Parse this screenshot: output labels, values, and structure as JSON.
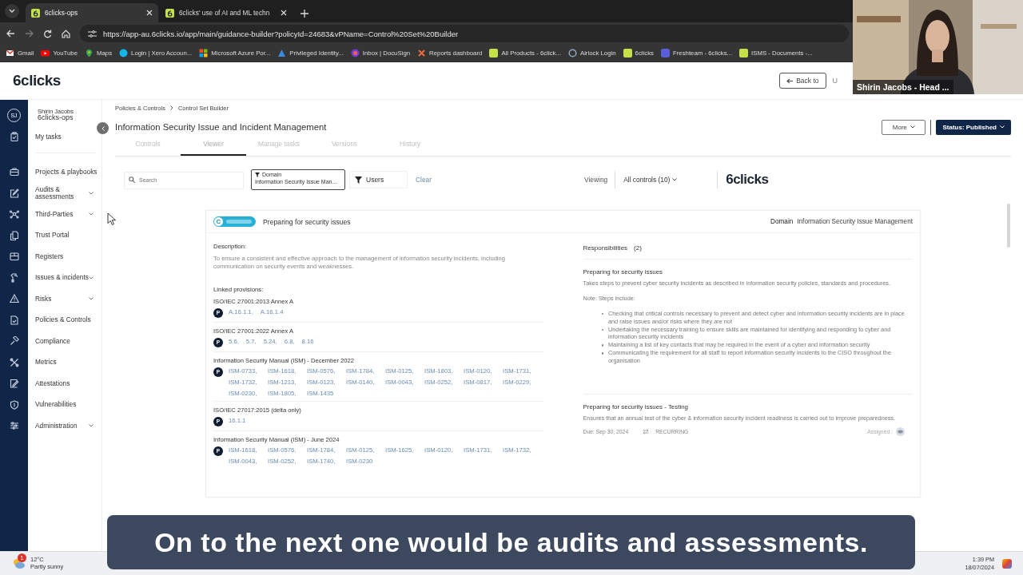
{
  "browser": {
    "tabs": [
      {
        "title": "6clicks-ops",
        "selected": true
      },
      {
        "title": "6clicks' use of AI and ML techn",
        "selected": false
      }
    ],
    "url": "https://app-au.6clicks.io/app/main/guidance-builder?policyId=24683&vPName=Control%20Set%20Builder",
    "bookmarks": [
      "Gmail",
      "YouTube",
      "Maps",
      "Login | Xero Accoun...",
      "Microsoft Azure Por...",
      "Privileged Identity...",
      "Inbox | DocuSign",
      "Reports dashboard",
      "All Products - 6click...",
      "Airlock Login",
      "6clicks",
      "Freshteam - 6clicks...",
      "ISMS - Documents -..."
    ]
  },
  "video": {
    "kind": "picture",
    "caption": "Shirin Jacobs - Head ..."
  },
  "app_header": {
    "logo": "6clicks",
    "back_button": "Back to",
    "next_button": "U"
  },
  "sidebar": {
    "user": {
      "initials": "SJ",
      "name": "Shirin Jacobs",
      "org": "6clicks-ops"
    },
    "my_tasks": "My tasks",
    "items": [
      {
        "label": "Projects & playbooks",
        "expandable": false
      },
      {
        "label": "Audits & assessments",
        "expandable": true
      },
      {
        "label": "Third-Parties",
        "expandable": true
      },
      {
        "label": "Trust Portal",
        "expandable": false
      },
      {
        "label": "Registers",
        "expandable": false
      },
      {
        "label": "Issues & incidents",
        "expandable": true
      },
      {
        "label": "Risks",
        "expandable": true
      },
      {
        "label": "Policies & Controls",
        "expandable": false
      },
      {
        "label": "Compliance",
        "expandable": false
      },
      {
        "label": "Metrics",
        "expandable": false
      },
      {
        "label": "Attestations",
        "expandable": false
      },
      {
        "label": "Vulnerabilities",
        "expandable": false
      },
      {
        "label": "Administration",
        "expandable": true
      }
    ]
  },
  "main": {
    "breadcrumb": [
      "Policies & Controls",
      "Control Set Builder"
    ],
    "title": "Information Security Issue and Incident Management",
    "more_button": "More",
    "status_button": "Status: Published",
    "tabs": [
      {
        "label": "Controls",
        "selected": false
      },
      {
        "label": "Viewer",
        "selected": true
      },
      {
        "label": "Manage tasks",
        "selected": false
      },
      {
        "label": "Versions",
        "selected": false
      },
      {
        "label": "History",
        "selected": false
      }
    ],
    "filters": {
      "search_placeholder": "Search",
      "domain_label": "Domain",
      "domain_value": "Information Security Issue Man...",
      "users": "Users",
      "clear": "Clear",
      "viewing_label": "Viewing",
      "viewing_value": "All controls (10)",
      "logo": "6clicks"
    },
    "control": {
      "badge": "C",
      "title": "Preparing for security issues",
      "domain_label": "Domain",
      "domain": "Information Security Issue Management",
      "description_label": "Description:",
      "description": "To ensure a consistent and effective approach to the management of information security incidents, including communication on security events and weaknesses.",
      "linked_label": "Linked provisions:",
      "provisions": [
        {
          "framework": "ISO/IEC 27001:2013 Annex A",
          "badge": "P",
          "items": [
            "A.16.1.1,",
            "A.16.1.4"
          ]
        },
        {
          "framework": "ISO/IEC 27001:2022 Annex A",
          "badge": "P",
          "items": [
            "5.6,",
            "5.7,",
            "5.24,",
            "6.8,",
            "8.16"
          ]
        },
        {
          "framework": "Information Security Manual (ISM) - December 2022",
          "badge": "P",
          "items": [
            "ISM-0733,",
            "ISM-1618,",
            "ISM-0576,",
            "ISM-1784,",
            "ISM-0125,",
            "ISM-1803,",
            "ISM-0120,",
            "ISM-1731,",
            "ISM-1732,",
            "ISM-1213,",
            "ISM-0123,",
            "ISM-0140,",
            "ISM-0043,",
            "ISM-0252,",
            "ISM-0817,",
            "ISM-0229,",
            "ISM-0230,",
            "ISM-1805,",
            "ISM-1435"
          ]
        },
        {
          "framework": "ISO/IEC 27017:2015 (delta only)",
          "badge": "P",
          "items": [
            "16.1.1"
          ]
        },
        {
          "framework": "Information Security Manual (ISM) - June 2024",
          "badge": "P",
          "items": [
            "ISM-1618,",
            "ISM-0576,",
            "ISM-1784,",
            "ISM-0125,",
            "ISM-1625,",
            "ISM-0120,",
            "ISM-1731,",
            "ISM-1732,",
            "ISM-0043,",
            "ISM-0252,",
            "ISM-1740,",
            "ISM-0230"
          ]
        }
      ],
      "responsibilities_label": "Responsibilities",
      "responsibilities_count": "(2)",
      "responsibilities": [
        {
          "title": "Preparing for security issues",
          "text": "Takes steps to prevent cyber security incidents as described in information security policies, standards and procedures.",
          "note": "Note: Steps include:",
          "bullets": [
            "Checking that critical controls necessary to prevent and detect cyber and information security incidents are in place and raise issues and/or risks where they are not",
            "Undertaking the necessary training to ensure skills are maintained for identifying and responding to cyber and information security incidents",
            "Maintaining a list of key contacts that may be required in the event of a cyber and information security",
            "Communicating the requirement for all staff to report information security incidents to the CISO throughout the organisation"
          ]
        },
        {
          "title": "Preparing for security issues - Testing",
          "text": "Ensures that an annual test of the cyber & information security incident readiness is carried out to improve preparedness.",
          "due": "Due: Sep 30, 2024",
          "recurrence": "RECURRING",
          "assigned": "Assigned :"
        }
      ]
    }
  },
  "caption": "On to the next one would be audits and assessments.",
  "taskbar": {
    "weather_badge": "1",
    "temperature": "12°C",
    "condition": "Partly sunny",
    "time": "1:39 PM",
    "date": "18/07/2024"
  }
}
